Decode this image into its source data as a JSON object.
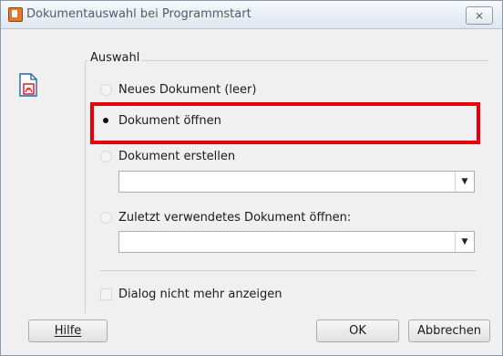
{
  "window": {
    "title": "Dokumentauswahl bei Programmstart",
    "close_label": "⨯"
  },
  "group": {
    "label": "Auswahl"
  },
  "options": {
    "neues": "Neues Dokument (leer)",
    "oeffnen": "Dokument öffnen",
    "erstellen": "Dokument erstellen",
    "zuletzt": "Zuletzt verwendetes Dokument öffnen:"
  },
  "selected_option": "Dokument öffnen",
  "combo_erstellen": {
    "value": ""
  },
  "combo_zuletzt": {
    "value": ""
  },
  "checkbox": {
    "label": "Dialog nicht mehr anzeigen",
    "checked": false
  },
  "buttons": {
    "help": "Hilfe",
    "ok": "OK",
    "cancel": "Abbrechen"
  },
  "colors": {
    "highlight": "#e8000b",
    "pdf_red": "#d40000"
  },
  "icons": {
    "app": "app-icon",
    "document": "pdf-document-icon",
    "close": "close-icon",
    "dropdown": "chevron-down-icon"
  }
}
